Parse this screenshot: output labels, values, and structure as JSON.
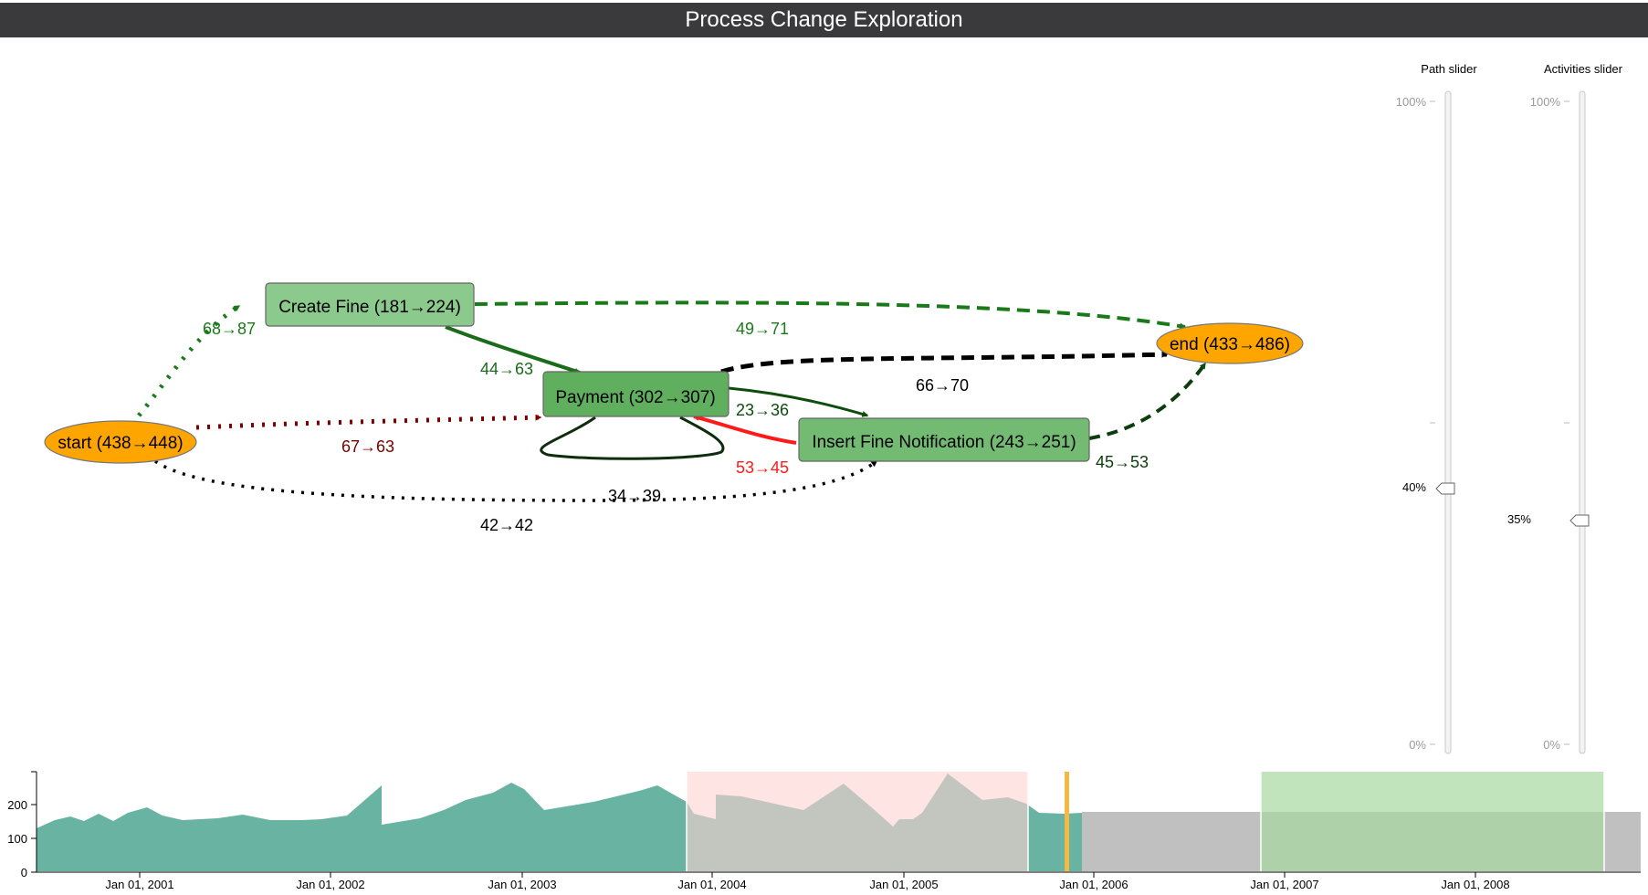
{
  "header": {
    "title": "Process Change Exploration"
  },
  "graph": {
    "nodes": {
      "start": "start (438→448)",
      "end": "end (433→486)",
      "create_fine": "Create Fine (181→224)",
      "payment": "Payment (302→307)",
      "insert_fine_notification": "Insert Fine Notification (243→251)"
    },
    "edges": {
      "start_create_fine": "68→87",
      "create_fine_end": "49→71",
      "create_fine_payment": "44→63",
      "payment_end": "66→70",
      "payment_insert": "23→36",
      "insert_payment": "53→45",
      "insert_end": "45→53",
      "start_payment": "67→63",
      "start_insert": "34→39",
      "payment_self": "42→42"
    },
    "colors": {
      "increase": "#1a7a1a",
      "decrease": "#8b0000",
      "neutral": "#000000",
      "strong_decrease": "#ff1a1a",
      "end_node": "#ffa500",
      "activity_node": "#6db56d"
    }
  },
  "sliders": {
    "path": {
      "title": "Path slider",
      "max_label": "100%",
      "min_label": "0%",
      "value_label": "40%",
      "value": 0.4
    },
    "activities": {
      "title": "Activities slider",
      "max_label": "100%",
      "min_label": "0%",
      "value_label": "35%",
      "value": 0.35
    }
  },
  "timeline": {
    "y_ticks": [
      "200",
      "100",
      "0"
    ],
    "x_ticks": [
      "Jan 01, 2001",
      "Jan 01, 2002",
      "Jan 01, 2003",
      "Jan 01, 2004",
      "Jan 01, 2005",
      "Jan 01, 2006",
      "Jan 01, 2007",
      "Jan 01, 2008"
    ],
    "colors": {
      "area": "#69b3a2",
      "before_window": "#ffd2d2",
      "after_window": "#a8d8a0",
      "future": "#c0c0c0",
      "marker": "#f5b942"
    }
  }
}
